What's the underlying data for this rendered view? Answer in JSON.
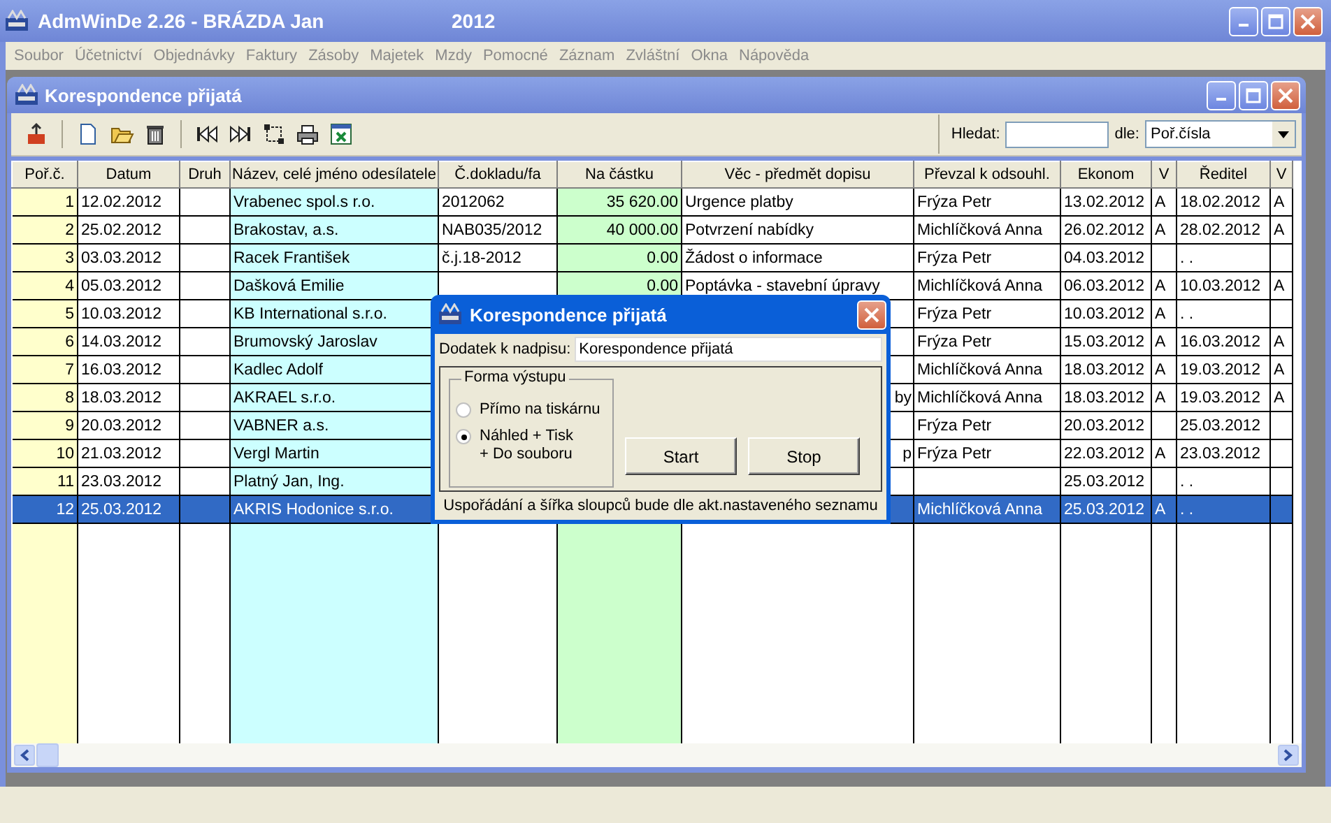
{
  "window": {
    "title": "AdmWinDe 2.26 - BRÁZDA Jan",
    "year": "2012"
  },
  "menu": [
    "Soubor",
    "Účetnictví",
    "Objednávky",
    "Faktury",
    "Zásoby",
    "Majetek",
    "Mzdy",
    "Pomocné",
    "Záznam",
    "Zvláštní",
    "Okna",
    "Nápověda"
  ],
  "child_window": {
    "title": "Korespondence přijatá"
  },
  "search": {
    "label": "Hledat:",
    "by_label": "dle:",
    "by_value": "Poř.čísla"
  },
  "table": {
    "columns": [
      "Poř.č.",
      "Datum",
      "Druh",
      "Název, celé jméno odesílatele",
      "Č.dokladu/fa",
      "Na částku",
      "Věc - předmět dopisu",
      "Převzal k odsouhl.",
      "Ekonom",
      "V",
      "Ředitel",
      "V"
    ],
    "rows": [
      {
        "kind": "plain",
        "selected": false,
        "cells": [
          "1",
          "12.02.2012",
          null,
          "Vrabenec spol.s r.o.",
          "2012062",
          "35 620.00",
          "Urgence platby",
          "Frýza Petr",
          "13.02.2012",
          "A",
          "18.02.2012",
          "A"
        ]
      },
      {
        "kind": "plain",
        "selected": false,
        "cells": [
          "2",
          "25.02.2012",
          null,
          "Brakostav, a.s.",
          "NAB035/2012",
          "40 000.00",
          "Potvrzení nabídky",
          "Michlíčková Anna",
          "26.02.2012",
          "A",
          "28.02.2012",
          "A"
        ]
      },
      {
        "kind": "plain",
        "selected": false,
        "cells": [
          "3",
          "03.03.2012",
          null,
          "Racek František",
          "č.j.18-2012",
          "0.00",
          "Žádost o informace",
          "Frýza Petr",
          "04.03.2012",
          null,
          ". .",
          null
        ]
      },
      {
        "kind": "plain",
        "selected": false,
        "cells": [
          "4",
          "05.03.2012",
          null,
          "Dašková Emilie",
          null,
          "0.00",
          "Poptávka - stavební úpravy",
          "Michlíčková Anna",
          "06.03.2012",
          "A",
          "10.03.2012",
          "A"
        ]
      },
      {
        "kind": "plain",
        "selected": false,
        "cells": [
          "5",
          "10.03.2012",
          null,
          "KB International s.r.o.",
          null,
          null,
          null,
          "Frýza Petr",
          "10.03.2012",
          "A",
          ". .",
          null
        ]
      },
      {
        "kind": "plain",
        "selected": false,
        "cells": [
          "6",
          "14.03.2012",
          null,
          "Brumovský Jaroslav",
          null,
          null,
          null,
          "Frýza Petr",
          "15.03.2012",
          "A",
          "16.03.2012",
          "A"
        ]
      },
      {
        "kind": "plain",
        "selected": false,
        "cells": [
          "7",
          "16.03.2012",
          null,
          "Kadlec  Adolf",
          null,
          null,
          null,
          "Michlíčková Anna",
          "18.03.2012",
          "A",
          "19.03.2012",
          "A"
        ]
      },
      {
        "kind": "covered",
        "selected": false,
        "cells": [
          "8",
          "18.03.2012",
          null,
          "AKRAEL s.r.o.",
          null,
          null,
          "by",
          "Michlíčková Anna",
          "18.03.2012",
          "A",
          "19.03.2012",
          "A"
        ]
      },
      {
        "kind": "plain",
        "selected": false,
        "cells": [
          "9",
          "20.03.2012",
          null,
          "VABNER a.s.",
          null,
          null,
          null,
          "Frýza Petr",
          "20.03.2012",
          null,
          "25.03.2012",
          null
        ]
      },
      {
        "kind": "covered",
        "selected": false,
        "cells": [
          "10",
          "21.03.2012",
          null,
          "Vergl Martin",
          null,
          null,
          "p",
          "Frýza Petr",
          "22.03.2012",
          "A",
          "23.03.2012",
          null
        ]
      },
      {
        "kind": "plain",
        "selected": false,
        "cells": [
          "11",
          "23.03.2012",
          null,
          "Platný Jan, Ing.",
          null,
          null,
          null,
          null,
          "25.03.2012",
          null,
          ". .",
          null
        ]
      },
      {
        "kind": "plain",
        "selected": true,
        "cells": [
          "12",
          "25.03.2012",
          null,
          "AKRIS Hodonice s.r.o.",
          null,
          null,
          null,
          "Michlíčková Anna",
          "25.03.2012",
          "A",
          ". .",
          null
        ]
      }
    ]
  },
  "dialog": {
    "title": "Korespondence přijatá",
    "field_label": "Dodatek k nadpisu:",
    "field_value": "Korespondence přijatá",
    "group_title": "Forma výstupu",
    "options": [
      {
        "label": "Přímo na tiskárnu",
        "selected": false
      },
      {
        "label": "Náhled + Tisk\n+ Do souboru",
        "selected": true
      }
    ],
    "buttons": [
      "Start",
      "Stop"
    ],
    "note": "Uspořádání a šířka sloupců bude dle akt.nastaveného seznamu"
  }
}
